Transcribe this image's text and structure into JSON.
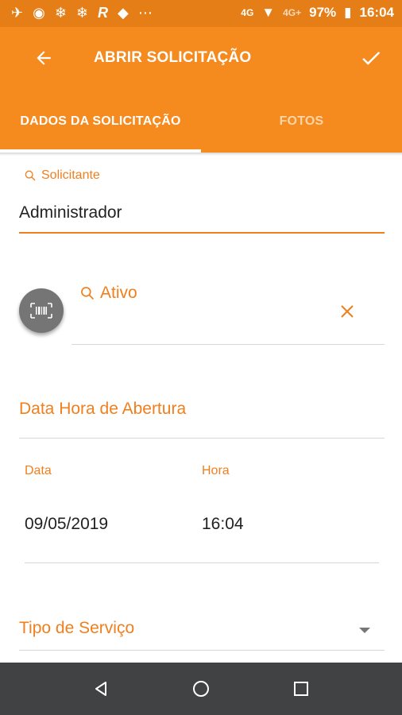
{
  "status_bar": {
    "icons": [
      "nav-arrow-icon",
      "pokeball-icon",
      "snowflake-icon",
      "snowflake-icon",
      "r-logo-icon",
      "app-icon",
      "more-dots-icon",
      "call-4g-icon",
      "wifi-icon",
      "signal-4g-icon",
      "battery-charging-icon"
    ],
    "network_label": "4G",
    "network_label_2": "4G+",
    "battery": "97%",
    "time": "16:04"
  },
  "app_bar": {
    "title": "ABRIR SOLICITAÇÃO"
  },
  "tabs": [
    {
      "label": "DADOS DA SOLICITAÇÃO",
      "active": true
    },
    {
      "label": "FOTOS",
      "active": false
    }
  ],
  "form": {
    "solicitante": {
      "label": "Solicitante",
      "value": "Administrador"
    },
    "ativo": {
      "label": "Ativo",
      "value": ""
    },
    "data_hora_title": "Data Hora de Abertura",
    "data": {
      "label": "Data",
      "value": "09/05/2019"
    },
    "hora": {
      "label": "Hora",
      "value": "16:04"
    },
    "tipo_servico": {
      "label": "Tipo de Serviço"
    }
  },
  "colors": {
    "accent": "#f58a1f",
    "accent_text": "#f07f1e",
    "status_bar": "#e67e17",
    "nav_bar": "#404243"
  }
}
